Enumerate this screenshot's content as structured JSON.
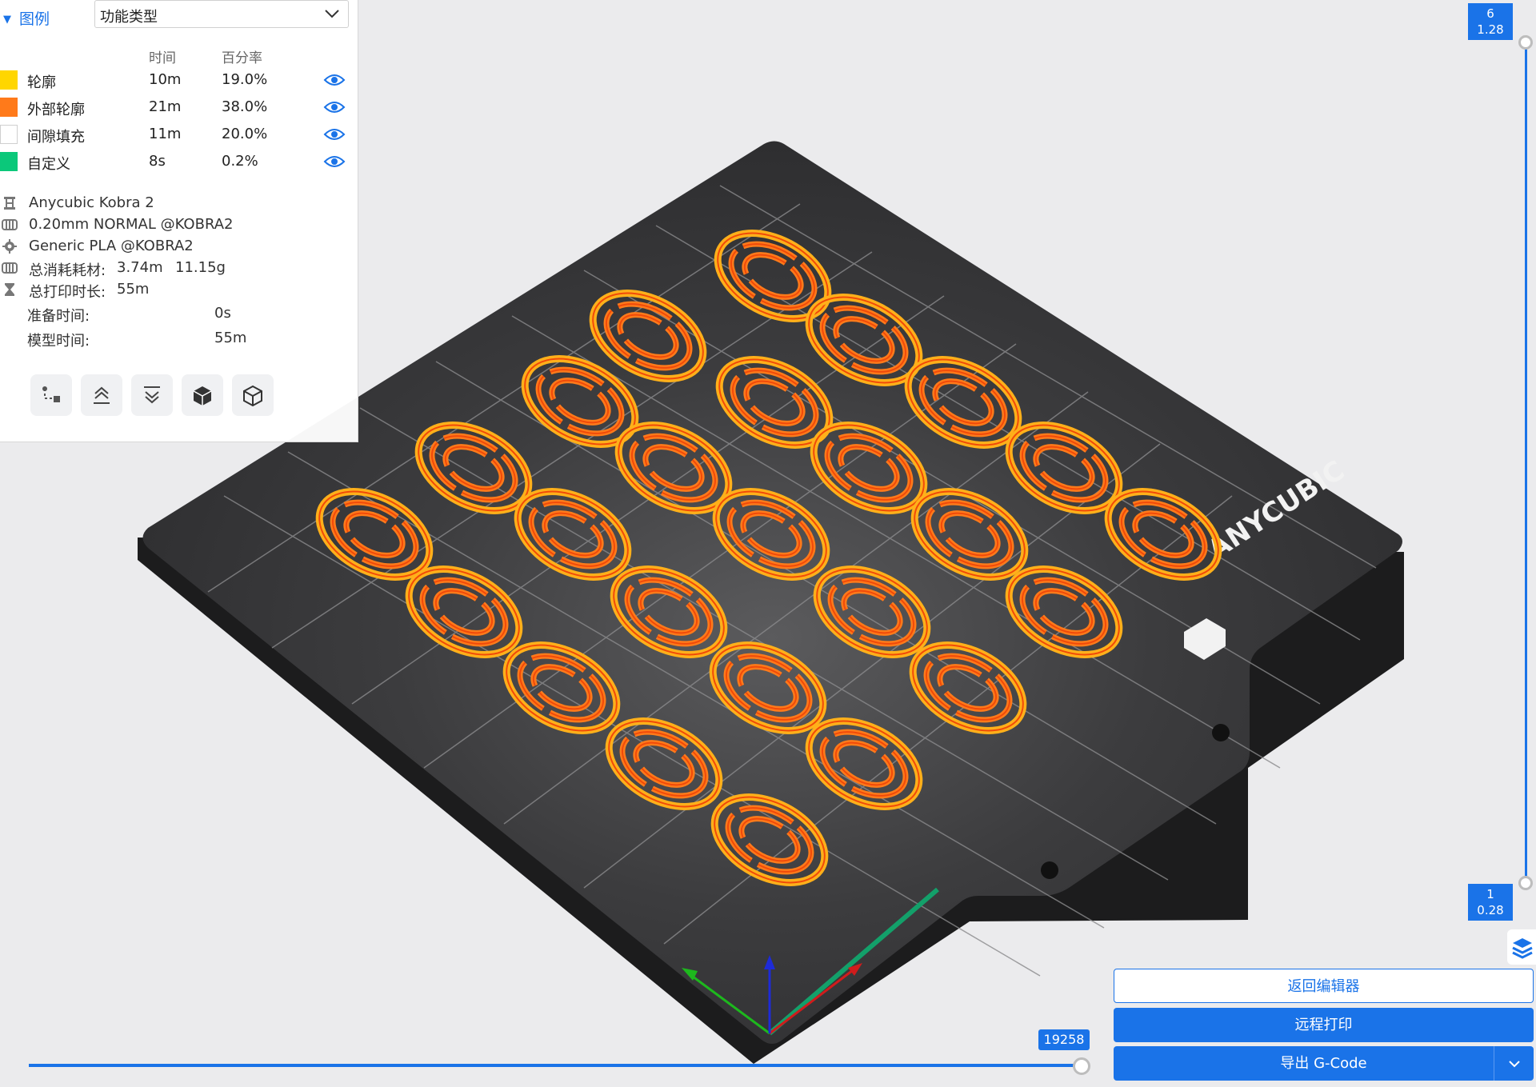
{
  "legend": {
    "title": "图例",
    "view_type": "功能类型",
    "col_time": "时间",
    "col_percent": "百分率",
    "rows": [
      {
        "name": "轮廓",
        "time": "10m",
        "percent": "19.0%",
        "color": "#ffd600"
      },
      {
        "name": "外部轮廓",
        "time": "21m",
        "percent": "38.0%",
        "color": "#ff7a1a"
      },
      {
        "name": "间隙填充",
        "time": "11m",
        "percent": "20.0%",
        "color": "#ffffff"
      },
      {
        "name": "自定义",
        "time": "8s",
        "percent": "0.2%",
        "color": "#0bc87a"
      }
    ]
  },
  "info": {
    "printer": "Anycubic Kobra 2",
    "process": "0.20mm NORMAL @KOBRA2",
    "filament": "Generic PLA @KOBRA2",
    "consumption_label": "总消耗耗材:",
    "consumption_length": "3.74m",
    "consumption_weight": "11.15g",
    "total_time_label": "总打印时长:",
    "total_time": "55m",
    "prep_label": "准备时间:",
    "prep_time": "0s",
    "model_label": "模型时间:",
    "model_time": "55m"
  },
  "toolbar": {
    "icons": [
      "travel-icon",
      "layer-up-icon",
      "layer-down-icon",
      "solid-cube-icon",
      "wire-cube-icon"
    ]
  },
  "layer_slider": {
    "top_layer": "6",
    "top_height": "1.28",
    "bottom_layer": "1",
    "bottom_height": "0.28"
  },
  "move_slider": {
    "value": "19258"
  },
  "bed": {
    "brand": "ANYCUBIC"
  },
  "actions": {
    "back_label": "返回编辑器",
    "remote_label": "远程打印",
    "export_label": "导出 G-Code"
  },
  "colors": {
    "accent": "#1a73e8",
    "bed": "#3a3a3c",
    "outline": "#ff7a1a"
  }
}
